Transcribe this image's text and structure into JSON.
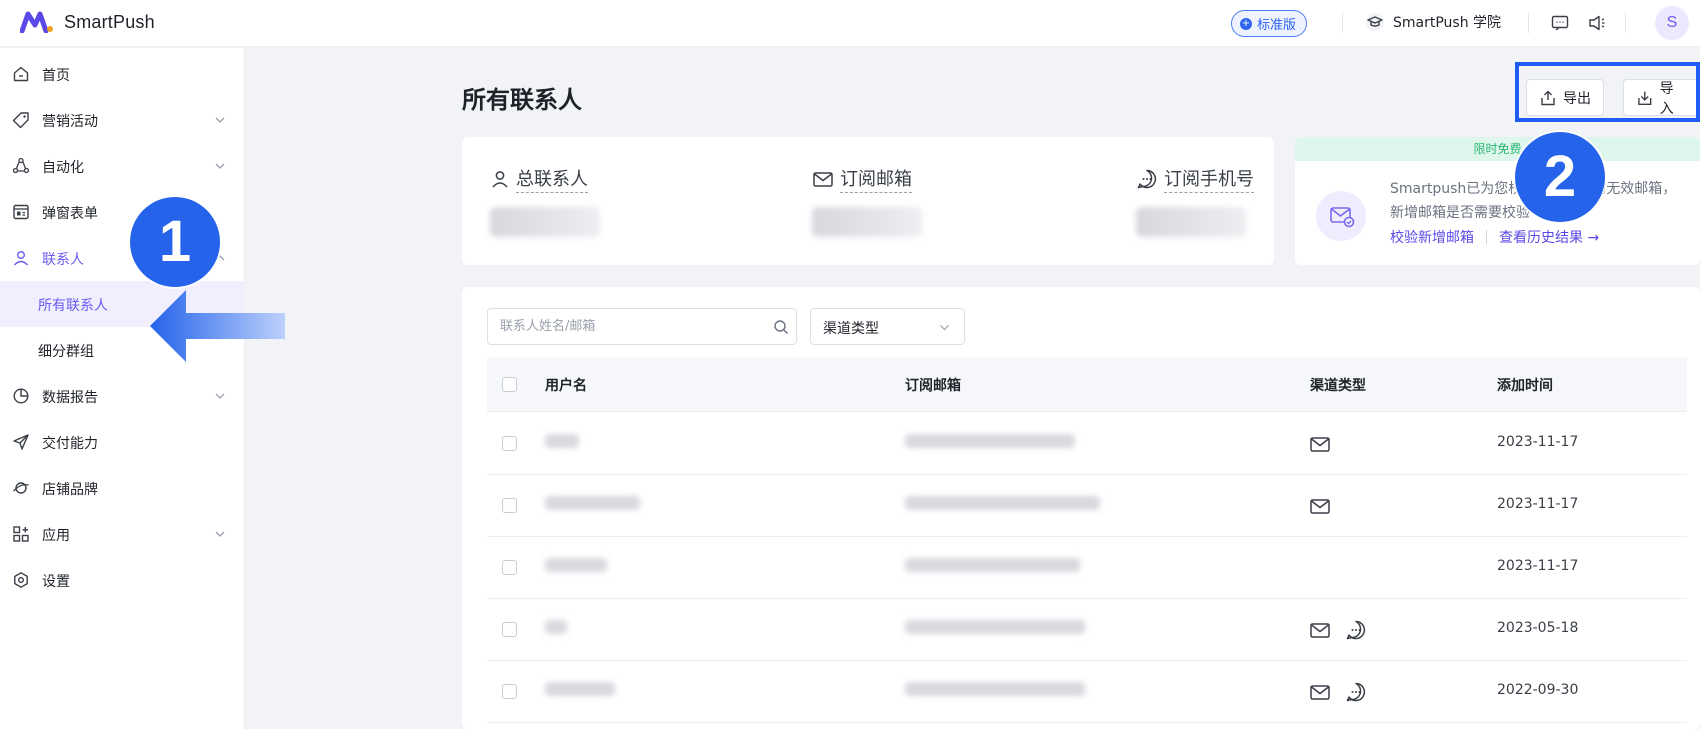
{
  "app": {
    "name": "SmartPush",
    "plan_badge": "标准版",
    "academy": "SmartPush 学院",
    "avatar_initial": "S"
  },
  "sidebar": {
    "items": [
      {
        "label": "首页",
        "icon": "home-icon"
      },
      {
        "label": "营销活动",
        "icon": "tag-icon"
      },
      {
        "label": "自动化",
        "icon": "automation-icon"
      },
      {
        "label": "弹窗表单",
        "icon": "form-icon"
      },
      {
        "label": "联系人",
        "icon": "user-icon"
      },
      {
        "label": "数据报告",
        "icon": "pie-chart-icon"
      },
      {
        "label": "交付能力",
        "icon": "send-icon"
      },
      {
        "label": "店铺品牌",
        "icon": "brand-icon"
      },
      {
        "label": "应用",
        "icon": "apps-icon"
      },
      {
        "label": "设置",
        "icon": "settings-icon"
      }
    ],
    "contacts_sub": {
      "all": "所有联系人",
      "segments": "细分群组"
    }
  },
  "main": {
    "title": "所有联系人",
    "export_label": "导出",
    "import_label": "导入",
    "stats": {
      "total": "总联系人",
      "email": "订阅邮箱",
      "sms": "订阅手机号"
    },
    "promo": {
      "ribbon": "限时免费",
      "line1": "Smartpush已为您校",
      "line1b": "的无效邮箱，",
      "line2": "新增邮箱是否需要校验",
      "link_verify": "校验新增邮箱",
      "link_history": "查看历史结果 →"
    },
    "search": {
      "placeholder": "联系人姓名/邮箱"
    },
    "channel_select": "渠道类型",
    "table": {
      "headers": {
        "username": "用户名",
        "email": "订阅邮箱",
        "channel": "渠道类型",
        "added": "添加时间"
      },
      "rows": [
        {
          "date": "2023-11-17",
          "channels": [
            "email"
          ]
        },
        {
          "date": "2023-11-17",
          "channels": [
            "email"
          ]
        },
        {
          "date": "2023-11-17",
          "channels": []
        },
        {
          "date": "2023-05-18",
          "channels": [
            "email",
            "sms"
          ]
        },
        {
          "date": "2022-09-30",
          "channels": [
            "email",
            "sms"
          ]
        }
      ]
    }
  },
  "callouts": {
    "one": "1",
    "two": "2"
  },
  "colors": {
    "accent": "#6a5cf0",
    "callout": "#2563eb",
    "highlight": "#1f5cf5"
  }
}
